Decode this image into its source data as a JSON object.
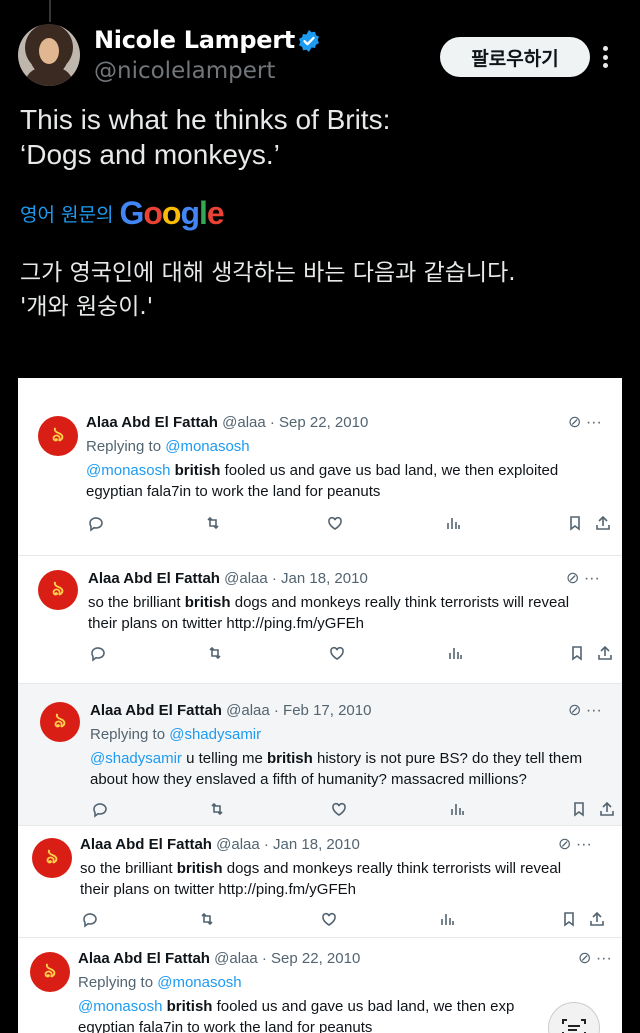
{
  "author": {
    "display_name": "Nicole Lampert",
    "handle": "@nicolelampert",
    "verified_icon": "verified-badge-icon"
  },
  "follow_button_label": "팔로우하기",
  "tweet": {
    "line1": "This is what he thinks of Brits:",
    "line2": "‘Dogs and monkeys.’"
  },
  "translation": {
    "label": "영어 원문의",
    "provider": "Google",
    "line1": "그가 영국인에 대해 생각하는 바는 다음과 같습니다.",
    "line2": "'개와 원숭이.'"
  },
  "embedded_tweets": [
    {
      "name": "Alaa Abd El Fattah",
      "meta": "@alaa · Sep 22, 2010",
      "replying_prefix": "Replying to ",
      "replying_to": "@monasosh",
      "mention": "@monasosh",
      "bold": "british",
      "text_line1_rest": " fooled us and gave us bad land, we then exploited",
      "text_line2": "egyptian fala7in to work the land for peanuts"
    },
    {
      "name": "Alaa Abd El Fattah",
      "meta": "@alaa · Jan 18, 2010",
      "text_line1_pre": "so the brilliant ",
      "bold": "british",
      "text_line1_rest": " dogs and monkeys really think terrorists will reveal",
      "text_line2": "their plans on twitter http://ping.fm/yGFEh"
    },
    {
      "name": "Alaa Abd El Fattah",
      "meta": "@alaa · Feb 17, 2010",
      "replying_prefix": "Replying to ",
      "replying_to": "@shadysamir",
      "mention": "@shadysamir",
      "text_line1_pre": " u telling me ",
      "bold": "british",
      "text_line1_rest": " history is not pure BS? do they tell them",
      "text_line2": "about how they enslaved a fifth of humanity? massacred millions?"
    },
    {
      "name": "Alaa Abd El Fattah",
      "meta": "@alaa · Jan 18, 2010",
      "text_line1_pre": "so the brilliant ",
      "bold": "british",
      "text_line1_rest": " dogs and monkeys really think terrorists will reveal",
      "text_line2": "their plans on twitter http://ping.fm/yGFEh"
    },
    {
      "name": "Alaa Abd El Fattah",
      "meta": "@alaa · Sep 22, 2010",
      "replying_prefix": "Replying to ",
      "replying_to": "@monasosh",
      "mention": "@monasosh",
      "bold": "british",
      "text_line1_rest": " fooled us and gave us bad land, we then exp",
      "text_line2": "egyptian fala7in to work the land for peanuts"
    }
  ],
  "colors": {
    "background": "#000000",
    "link": "#1d9bf0",
    "avatar_red": "#d81e15"
  }
}
